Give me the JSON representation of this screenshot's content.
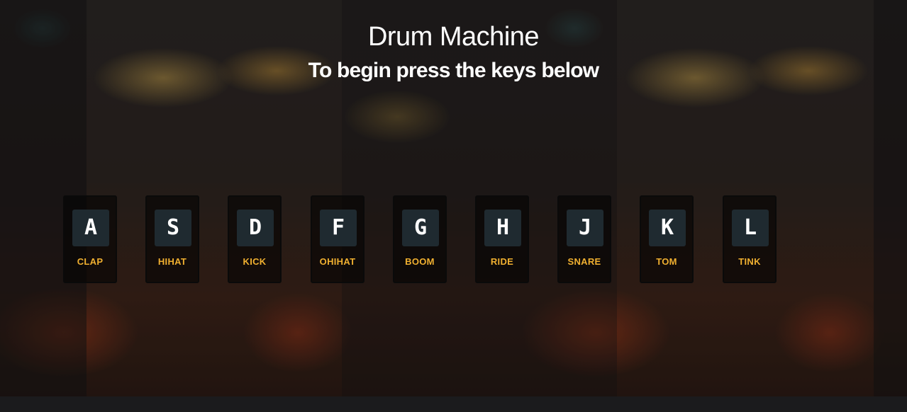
{
  "header": {
    "title": "Drum Machine",
    "subtitle": "To begin press the keys below"
  },
  "keys": [
    {
      "letter": "A",
      "sound": "CLAP"
    },
    {
      "letter": "S",
      "sound": "HIHAT"
    },
    {
      "letter": "D",
      "sound": "KICK"
    },
    {
      "letter": "F",
      "sound": "OHIHAT"
    },
    {
      "letter": "G",
      "sound": "BOOM"
    },
    {
      "letter": "H",
      "sound": "RIDE"
    },
    {
      "letter": "J",
      "sound": "SNARE"
    },
    {
      "letter": "K",
      "sound": "TOM"
    },
    {
      "letter": "L",
      "sound": "TINK"
    }
  ],
  "colors": {
    "sound_label": "#f0b030",
    "letter_box": "#1f2a30",
    "page_background": "#1b1b1d"
  }
}
